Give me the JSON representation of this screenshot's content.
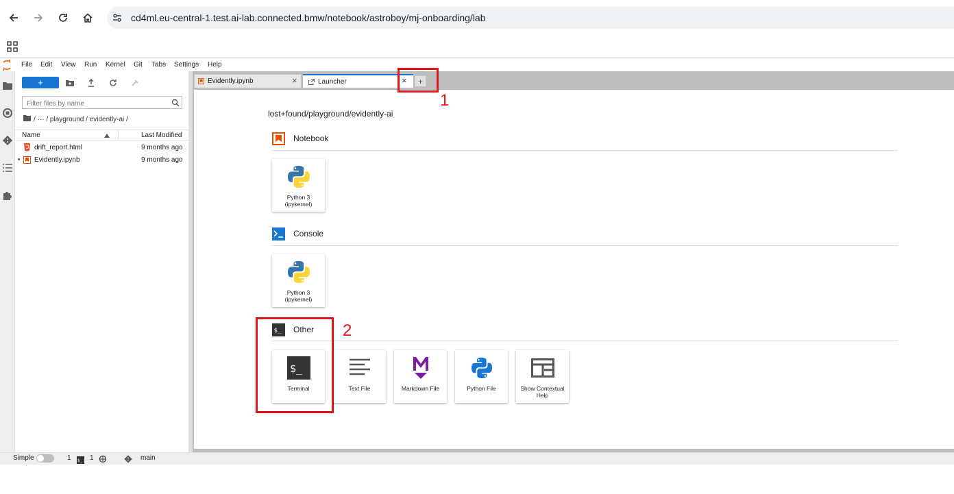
{
  "browser": {
    "url": "cd4ml.eu-central-1.test.ai-lab.connected.bmw/notebook/astroboy/mj-onboarding/lab"
  },
  "menu": [
    "File",
    "Edit",
    "View",
    "Run",
    "Kernel",
    "Git",
    "Tabs",
    "Settings",
    "Help"
  ],
  "file_browser": {
    "new_label": "+",
    "filter_placeholder": "Filter files by name",
    "breadcrumb": "/   ···   / playground / evidently-ai /",
    "col_name": "Name",
    "col_modified": "Last Modified",
    "files": [
      {
        "name": "drift_report.html",
        "modified": "9 months ago"
      },
      {
        "name": "Evidently.ipynb",
        "modified": "9 months ago"
      }
    ]
  },
  "tabs": [
    {
      "label": "Evidently.ipynb"
    },
    {
      "label": "Launcher"
    }
  ],
  "launcher": {
    "cwd": "lost+found/playground/evidently-ai",
    "sections": {
      "notebook": {
        "title": "Notebook",
        "card_label": "Python 3 (ipykernel)"
      },
      "console": {
        "title": "Console",
        "card_label": "Python 3 (ipykernel)"
      },
      "other": {
        "title": "Other",
        "cards": [
          "Terminal",
          "Text File",
          "Markdown File",
          "Python File",
          "Show Contextual Help"
        ]
      }
    }
  },
  "annotations": {
    "one": "1",
    "two": "2"
  },
  "status": {
    "mode_label": "Simple",
    "count_a": "1",
    "count_b": "1",
    "branch": "main"
  },
  "colors": {
    "accent": "#1976d2",
    "annotation_red": "#e0141b",
    "notebook_orange": "#e65100",
    "console_blue": "#1976d2",
    "markdown_purple": "#7b1fa2"
  }
}
